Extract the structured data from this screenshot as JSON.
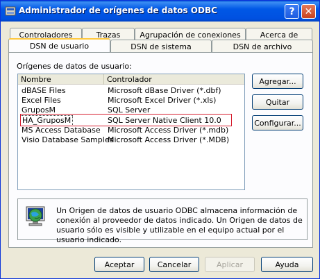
{
  "window": {
    "title": "Administrador de orígenes de datos ODBC",
    "help_glyph": "?",
    "close_glyph": "✕"
  },
  "tabs": {
    "row1": [
      "Controladores",
      "Trazas",
      "Agrupación de conexiones",
      "Acerca de"
    ],
    "row2": [
      "DSN de usuario",
      "DSN de sistema",
      "DSN de archivo"
    ],
    "active": "DSN de usuario"
  },
  "list": {
    "label": "Orígenes de datos de usuario:",
    "columns": [
      "Nombre",
      "Controlador"
    ],
    "rows": [
      {
        "name": "dBASE Files",
        "driver": "Microsoft dBase Driver (*.dbf)"
      },
      {
        "name": "Excel Files",
        "driver": "Microsoft Excel Driver (*.xls)"
      },
      {
        "name": "GruposM",
        "driver": "SQL Server"
      },
      {
        "name": "HA_GruposM",
        "driver": "SQL Server Native Client 10.0"
      },
      {
        "name": "MS Access Database",
        "driver": "Microsoft Access Driver (*.mdb)"
      },
      {
        "name": "Visio Database Samples",
        "driver": "Microsoft Access Driver (*.MDB)"
      }
    ],
    "selected_index": 3
  },
  "side_buttons": {
    "add": "Agregar...",
    "remove": "Quitar",
    "configure": "Configurar..."
  },
  "info": {
    "text": "Un Origen de datos de usuario ODBC almacena información de conexión al proveedor de datos indicado. Un Origen de datos de usuario sólo es visible y utilizable en el equipo actual por el usuario indicado."
  },
  "footer": {
    "ok": "Aceptar",
    "cancel": "Cancelar",
    "apply": "Aplicar",
    "help": "Ayuda"
  },
  "colors": {
    "highlight_outline": "#d61e2f",
    "titlebar": "#0058e6",
    "active_tab_accent": "#ffc83c"
  }
}
